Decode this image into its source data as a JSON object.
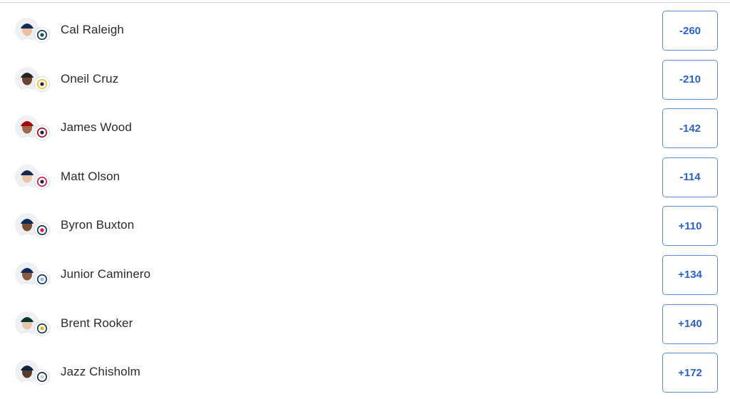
{
  "players": [
    {
      "name": "Cal Raleigh",
      "odds": "-260",
      "team_icon": "mariners-logo-icon",
      "team_color": "#0c2c56",
      "accent": "#005c5c",
      "skin": "#e8c0a0",
      "cap": "#0c2c56",
      "mark": "◎"
    },
    {
      "name": "Oneil Cruz",
      "odds": "-210",
      "team_icon": "pirates-logo-icon",
      "team_color": "#fdb827",
      "accent": "#27251f",
      "skin": "#6b4530",
      "cap": "#27251f",
      "mark": "P"
    },
    {
      "name": "James Wood",
      "odds": "-142",
      "team_icon": "nationals-logo-icon",
      "team_color": "#ab0003",
      "accent": "#14225a",
      "skin": "#a06a4a",
      "cap": "#ab0003",
      "mark": "W"
    },
    {
      "name": "Matt Olson",
      "odds": "-114",
      "team_icon": "braves-logo-icon",
      "team_color": "#ce1141",
      "accent": "#13274f",
      "skin": "#e8c4a8",
      "cap": "#13274f",
      "mark": "A"
    },
    {
      "name": "Byron Buxton",
      "odds": "+110",
      "team_icon": "twins-logo-icon",
      "team_color": "#002b5c",
      "accent": "#d31145",
      "skin": "#7a4e35",
      "cap": "#002b5c",
      "mark": "◎"
    },
    {
      "name": "Junior Caminero",
      "odds": "+134",
      "team_icon": "rays-logo-icon",
      "team_color": "#092c5c",
      "accent": "#8fbce6",
      "skin": "#8a5a3e",
      "cap": "#092c5c",
      "mark": "Rays"
    },
    {
      "name": "Brent Rooker",
      "odds": "+140",
      "team_icon": "athletics-logo-icon",
      "team_color": "#003831",
      "accent": "#efb21e",
      "skin": "#e8c6aa",
      "cap": "#003831",
      "mark": "A's"
    },
    {
      "name": "Jazz Chisholm",
      "odds": "+172",
      "team_icon": "yankees-logo-icon",
      "team_color": "#0c2340",
      "accent": "#c4ced3",
      "skin": "#5a3a28",
      "cap": "#0c2340",
      "mark": "NY"
    }
  ]
}
